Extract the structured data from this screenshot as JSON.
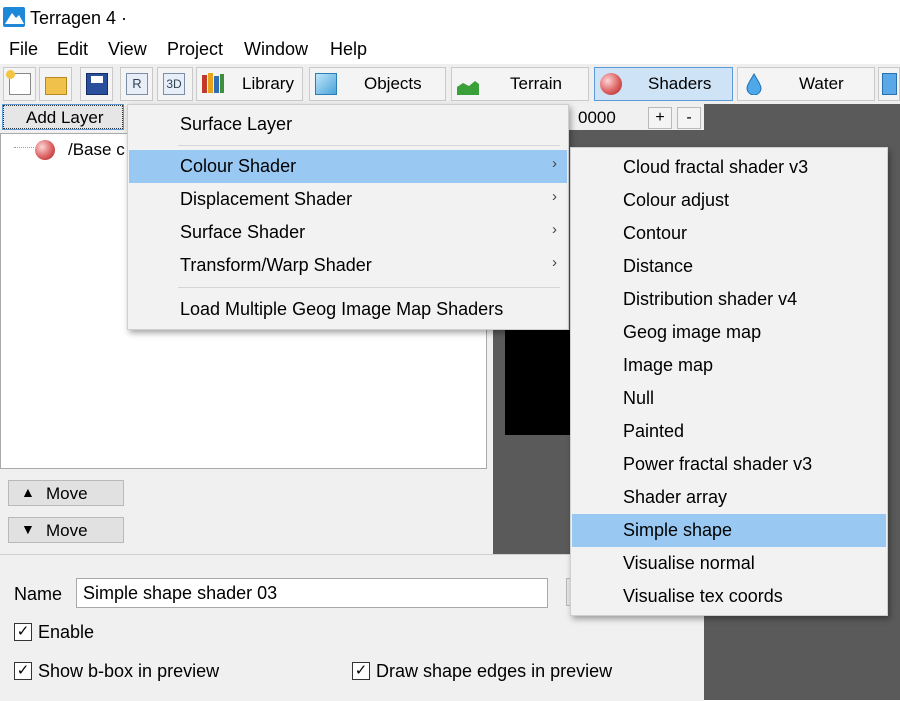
{
  "window": {
    "title": "Terragen 4 ·"
  },
  "menubar": [
    "File",
    "Edit",
    "View",
    "Project",
    "Window",
    "Help"
  ],
  "toolbar": {
    "library": "Library",
    "objects": "Objects",
    "terrain": "Terrain",
    "shaders": "Shaders",
    "water": "Water"
  },
  "left_panel": {
    "add_layer": "Add Layer",
    "tree_item": "/Base c",
    "move_up": "Move",
    "move_down": "Move"
  },
  "middle": {
    "value": "0000",
    "plus": "+",
    "minus": "-"
  },
  "add_layer_menu": {
    "items": [
      "Surface Layer",
      "Colour Shader",
      "Displacement Shader",
      "Surface Shader",
      "Transform/Warp Shader",
      "Load Multiple Geog Image Map Shaders"
    ]
  },
  "colour_shader_menu": {
    "items": [
      "Cloud fractal shader v3",
      "Colour adjust",
      "Contour",
      "Distance",
      "Distribution shader v4",
      "Geog image map",
      "Image map",
      "Null",
      "Painted",
      "Power fractal shader v3",
      "Shader array",
      "Simple shape",
      "Visualise normal",
      "Visualise tex coords"
    ],
    "selected": "Simple shape"
  },
  "bottom_panel": {
    "name_label": "Name",
    "name_value": "Simple shape shader 03",
    "enable_label": "Enable",
    "bbox_label": "Show b-box in preview",
    "edges_label": "Draw shape edges in preview"
  },
  "colors": {
    "highlight": "#99c9f3",
    "dark_bg": "#5a5a5a",
    "active_tab": "#cfe3f7"
  }
}
